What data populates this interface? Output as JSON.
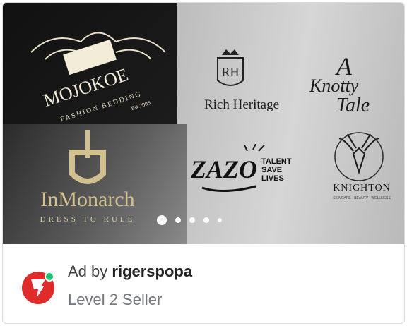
{
  "ad": {
    "prefix": "Ad by",
    "seller": "rigerspopa",
    "level": "Level 2 Seller"
  },
  "logos": {
    "mojokoe": "MOJOKOE",
    "mojokoe_sub": "FASHION BEDDING",
    "mojokoe_est": "Est 2006",
    "rich_heritage": "Rich Heritage",
    "rh_monogram": "RH",
    "knotty_a": "A",
    "knotty_line1": "Knotty",
    "knotty_line2": "Tale",
    "inmonarch": "InMonarch",
    "inmonarch_sub": "DRESS TO RULE",
    "zazo": "ZAZO",
    "talent_line1": "TALENT",
    "talent_line2": "SAVE",
    "talent_line3": "LIVES",
    "knighton": "KNIGHTON",
    "knighton_sub": "SKINCARE · BEAUTY · WELLNESS"
  },
  "carousel": {
    "count": 5,
    "active_index": 0
  },
  "colors": {
    "gold": "#d2c08f",
    "avatar_red": "#e02b2b",
    "online_green": "#1dbf73"
  },
  "icons": {
    "avatar": "seller-avatar-icon",
    "online": "online-status-icon"
  }
}
